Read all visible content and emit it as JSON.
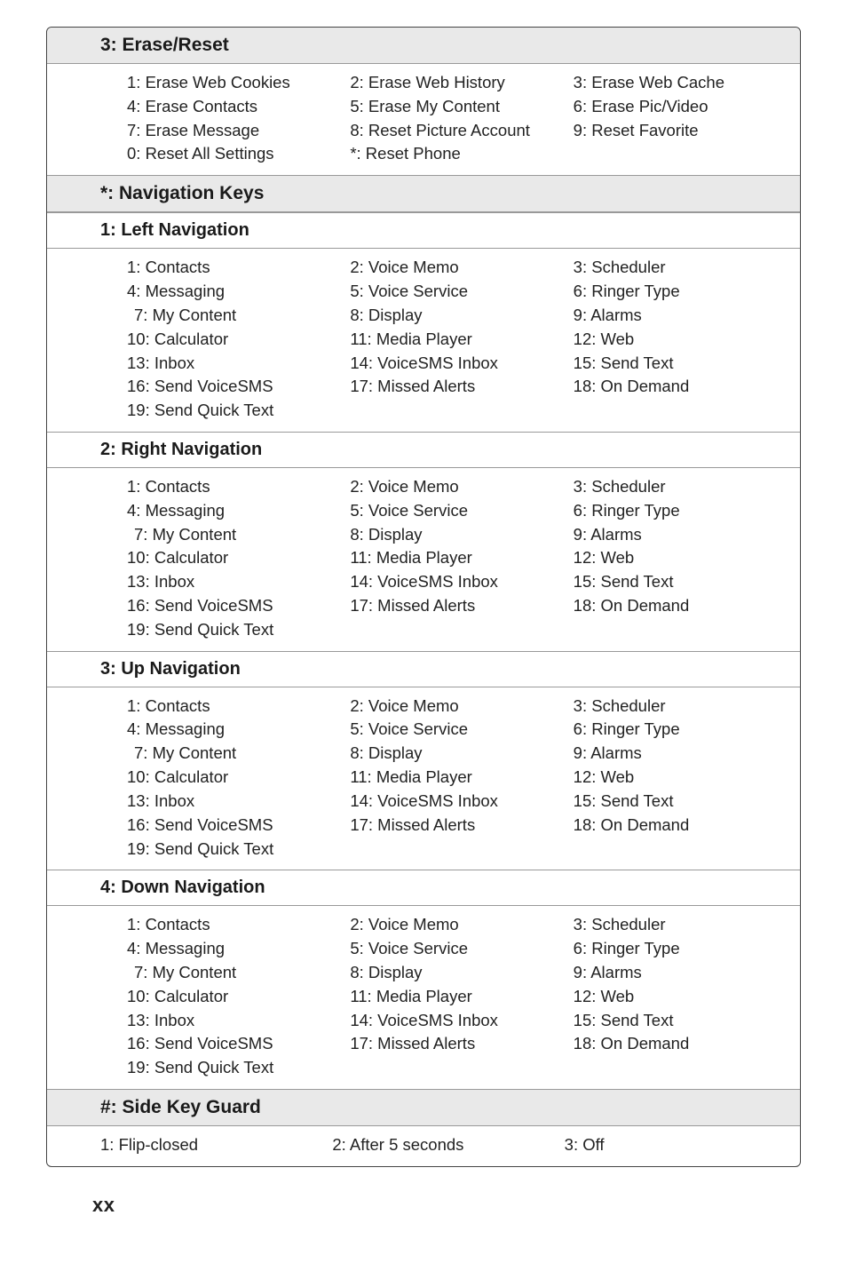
{
  "erase_reset": {
    "title": "3: Erase/Reset",
    "col1": [
      "1: Erase Web Cookies",
      "4: Erase Contacts",
      "7: Erase Message",
      "0: Reset All Settings"
    ],
    "col2": [
      "2: Erase Web History",
      "5: Erase My Content",
      "8: Reset Picture Account",
      "*:  Reset Phone"
    ],
    "col3": [
      "3: Erase Web Cache",
      "6: Erase Pic/Video",
      "9: Reset Favorite"
    ]
  },
  "nav_keys": {
    "title": "*: Navigation Keys"
  },
  "left_nav": {
    "title": "1: Left Navigation",
    "col1": [
      "1: Contacts",
      "4: Messaging",
      "7: My Content",
      "10: Calculator",
      "13: Inbox",
      "16: Send VoiceSMS",
      "19: Send Quick Text"
    ],
    "col2": [
      "2: Voice Memo",
      "5: Voice Service",
      "8: Display",
      "11: Media Player",
      "14: VoiceSMS Inbox",
      "17: Missed Alerts"
    ],
    "col3": [
      "3: Scheduler",
      "6: Ringer Type",
      "9: Alarms",
      "12: Web",
      "15: Send Text",
      "18: On Demand"
    ]
  },
  "right_nav": {
    "title": "2: Right Navigation",
    "col1": [
      "1: Contacts",
      "4: Messaging",
      "7: My Content",
      "10: Calculator",
      "13: Inbox",
      "16: Send VoiceSMS",
      "19: Send Quick Text"
    ],
    "col2": [
      "2: Voice Memo",
      "5: Voice Service",
      "8: Display",
      "11: Media Player",
      "14: VoiceSMS Inbox",
      "17: Missed Alerts"
    ],
    "col3": [
      "3: Scheduler",
      "6: Ringer Type",
      "9: Alarms",
      "12: Web",
      "15: Send Text",
      "18: On Demand"
    ]
  },
  "up_nav": {
    "title": "3: Up Navigation",
    "col1": [
      "1: Contacts",
      "4: Messaging",
      "7: My Content",
      "10: Calculator",
      "13: Inbox",
      "16: Send VoiceSMS",
      "19: Send Quick Text"
    ],
    "col2": [
      "2: Voice Memo",
      "5: Voice Service",
      "8: Display",
      "11: Media Player",
      "14: VoiceSMS Inbox",
      "17: Missed Alerts"
    ],
    "col3": [
      "3: Scheduler",
      "6: Ringer Type",
      "9: Alarms",
      "12: Web",
      "15: Send Text",
      "18: On Demand"
    ]
  },
  "down_nav": {
    "title": "4: Down Navigation",
    "col1": [
      "1: Contacts",
      "4: Messaging",
      "7: My Content",
      "10: Calculator",
      "13: Inbox",
      "16: Send VoiceSMS",
      "19: Send Quick Text"
    ],
    "col2": [
      "2: Voice Memo",
      "5: Voice Service",
      "8: Display",
      "11: Media Player",
      "14: VoiceSMS Inbox",
      "17: Missed Alerts"
    ],
    "col3": [
      "3: Scheduler",
      "6: Ringer Type",
      "9: Alarms",
      "12: Web",
      "15: Send Text",
      "18: On Demand"
    ]
  },
  "side_key": {
    "title": "#: Side Key Guard",
    "col1": [
      "1: Flip-closed"
    ],
    "col2": [
      "2: After 5 seconds"
    ],
    "col3": [
      "3: Off"
    ]
  },
  "page_num": "xx"
}
